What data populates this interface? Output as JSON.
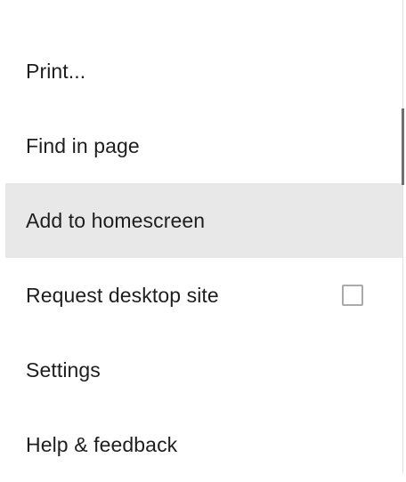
{
  "menu": {
    "items": [
      {
        "label": "Print..."
      },
      {
        "label": "Find in page"
      },
      {
        "label": "Add to homescreen",
        "highlighted": true
      },
      {
        "label": "Request desktop site",
        "checkbox": false
      },
      {
        "label": "Settings"
      },
      {
        "label": "Help & feedback"
      }
    ]
  },
  "colors": {
    "highlight": "#e8e8e8",
    "text": "#1e1e1e",
    "checkbox_border": "#a9a9a9"
  }
}
